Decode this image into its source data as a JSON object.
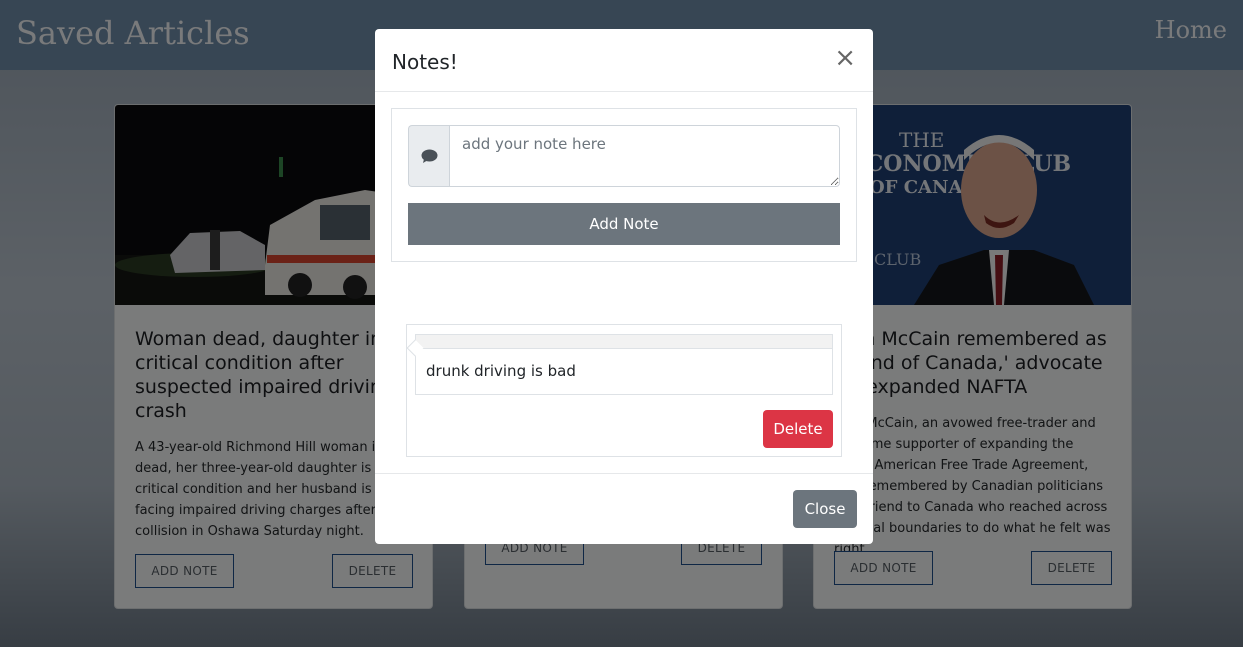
{
  "navbar": {
    "brand": "Saved Articles",
    "home_link": "Home"
  },
  "articles": [
    {
      "title": "Woman dead, daughter in critical condition after suspected impaired driving crash",
      "summary": "A 43-year-old Richmond Hill woman is dead, her three-year-old daughter is in critical condition and her husband is facing impaired driving charges after a collision in Oshawa Saturday night.",
      "add_note_label": "ADD NOTE",
      "delete_label": "DELETE"
    },
    {
      "title": "",
      "summary": "",
      "add_note_label": "ADD NOTE",
      "delete_label": "DELETE"
    },
    {
      "title": "John McCain remembered as 'friend of Canada,' advocate for expanded NAFTA",
      "summary": "John McCain, an avowed free-trader and longtime supporter of expanding the North American Free Trade Agreement, was remembered by Canadian politicians as a friend to Canada who reached across political boundaries to do what he felt was right.",
      "add_note_label": "ADD NOTE",
      "delete_label": "DELETE",
      "image_caption_lines": [
        "THE",
        "ECONOMIC CLUB",
        "OF CANADA",
        "CLUB"
      ]
    }
  ],
  "modal": {
    "title": "Notes!",
    "close_icon": "×",
    "icon": "comment-icon",
    "note_placeholder": "add your note here",
    "add_note_label": "Add Note",
    "notes": [
      {
        "text": "drunk driving is bad",
        "delete_label": "Delete"
      }
    ],
    "close_label": "Close"
  },
  "colors": {
    "navbar": "#6f8ca9",
    "add_note_button": "#6c757d",
    "delete_button": "#dc3545",
    "close_button": "#6c757d"
  }
}
